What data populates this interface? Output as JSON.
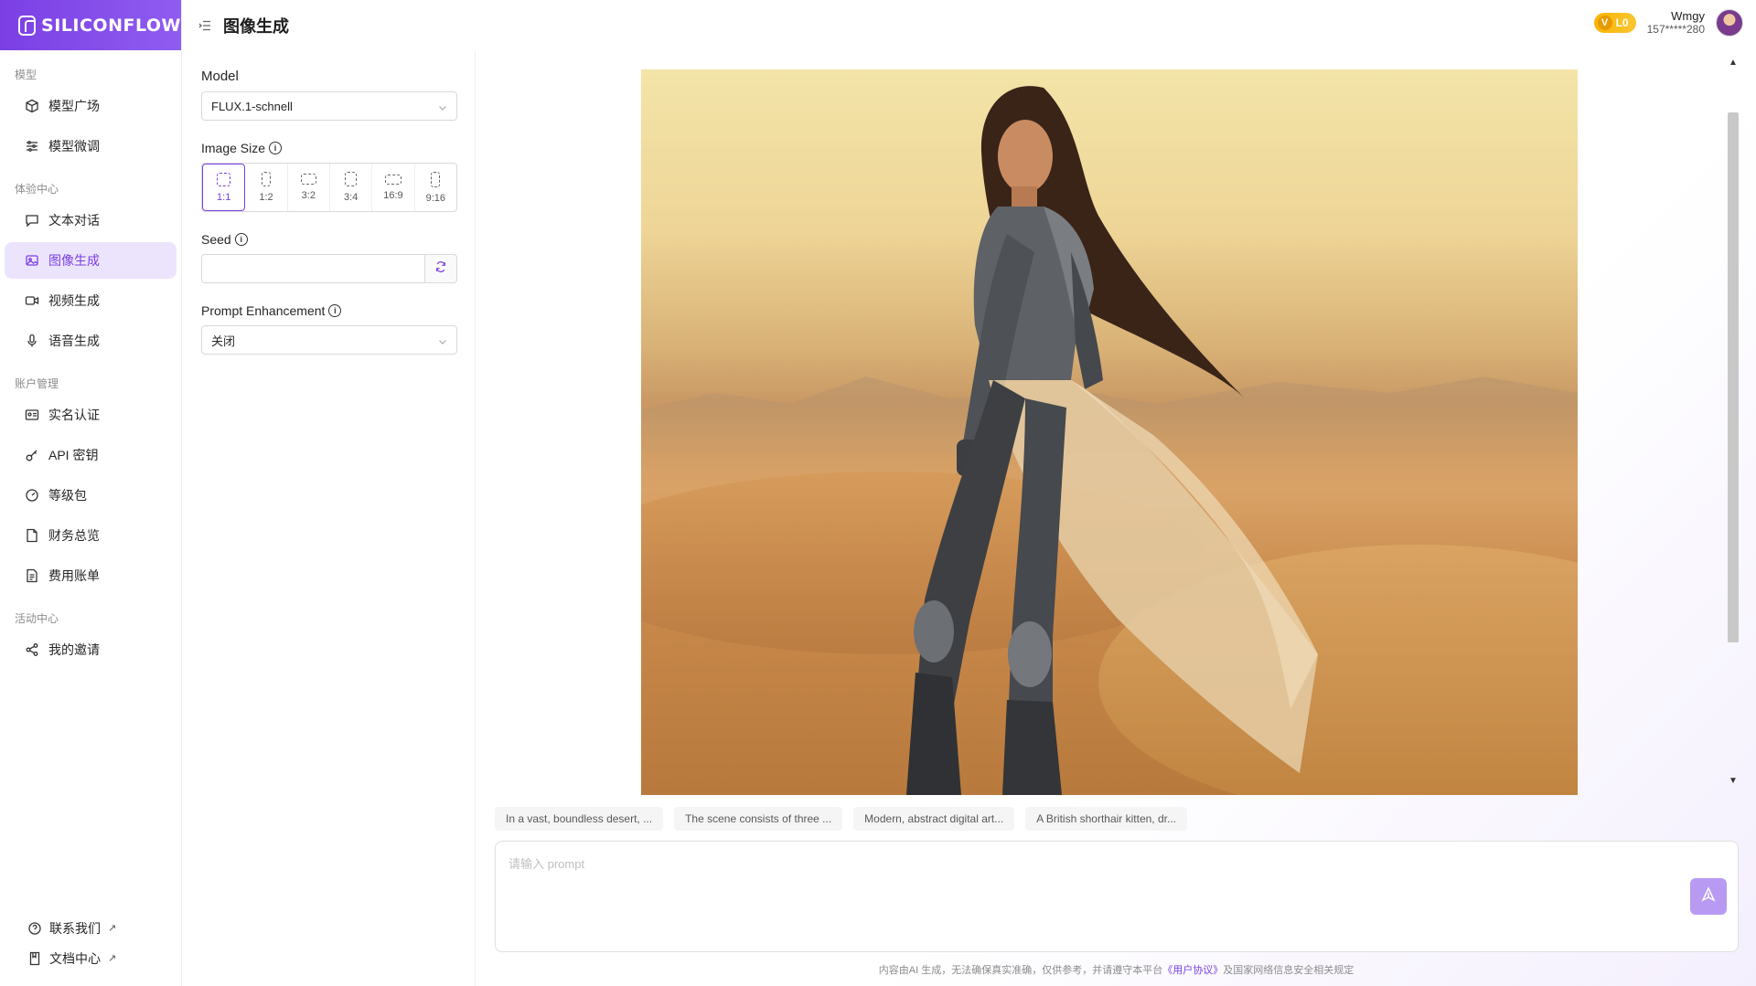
{
  "brand": {
    "name": "SILICONFLOW",
    "accent": "#7b3fe4"
  },
  "sidebar": {
    "sections": [
      {
        "title": "模型",
        "items": [
          {
            "label": "模型广场",
            "icon": "cube-icon"
          },
          {
            "label": "模型微调",
            "icon": "sliders-icon"
          }
        ]
      },
      {
        "title": "体验中心",
        "items": [
          {
            "label": "文本对话",
            "icon": "chat-icon"
          },
          {
            "label": "图像生成",
            "icon": "image-icon",
            "active": true
          },
          {
            "label": "视频生成",
            "icon": "video-icon"
          },
          {
            "label": "语音生成",
            "icon": "mic-icon"
          }
        ]
      },
      {
        "title": "账户管理",
        "items": [
          {
            "label": "实名认证",
            "icon": "id-card-icon"
          },
          {
            "label": "API 密钥",
            "icon": "key-icon"
          },
          {
            "label": "等级包",
            "icon": "gauge-icon"
          },
          {
            "label": "财务总览",
            "icon": "document-icon"
          },
          {
            "label": "费用账单",
            "icon": "bill-icon"
          }
        ]
      },
      {
        "title": "活动中心",
        "items": [
          {
            "label": "我的邀请",
            "icon": "share-icon"
          }
        ]
      }
    ],
    "footer": [
      {
        "label": "联系我们",
        "icon": "help-icon"
      },
      {
        "label": "文档中心",
        "icon": "doc-icon"
      }
    ]
  },
  "header": {
    "title": "图像生成",
    "level": "L0",
    "level_letter": "V",
    "user_name": "Wmgy",
    "user_phone": "157*****280"
  },
  "settings": {
    "model_label": "Model",
    "model_value": "FLUX.1-schnell",
    "size_label": "Image Size",
    "sizes": [
      "1:1",
      "1:2",
      "3:2",
      "3:4",
      "16:9",
      "9:16"
    ],
    "size_selected": "1:1",
    "seed_label": "Seed",
    "seed_value": "",
    "enhance_label": "Prompt Enhancement",
    "enhance_value": "关闭"
  },
  "main": {
    "chips": [
      "In a vast, boundless desert, ...",
      "The scene consists of three ...",
      "Modern, abstract digital art...",
      "A British shorthair kitten, dr..."
    ],
    "prompt_placeholder": "请输入 prompt",
    "prompt_value": ""
  },
  "footer": {
    "disclaimer_prefix": "内容由AI 生成，无法确保真实准确，仅供参考，并请遵守本平台",
    "disclaimer_link": "《用户协议》",
    "disclaimer_suffix": "及国家网络信息安全相关规定"
  }
}
